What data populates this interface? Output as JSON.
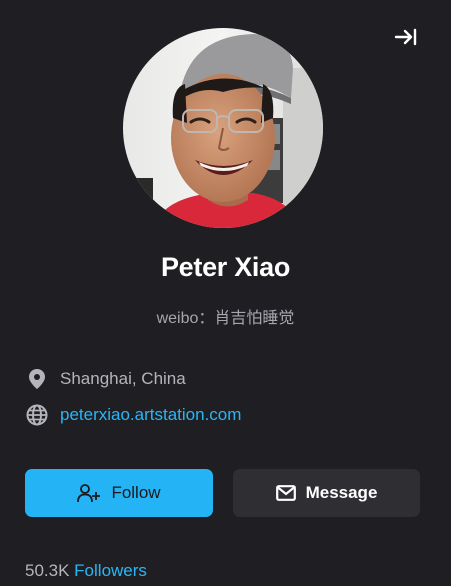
{
  "profile": {
    "name": "Peter Xiao",
    "headline": "weibo：肖吉怕睡觉",
    "location": "Shanghai, China",
    "website": "peterxiao.artstation.com"
  },
  "actions": {
    "follow_label": "Follow",
    "message_label": "Message"
  },
  "stats": {
    "followers_count": "50.3K",
    "followers_label": "Followers"
  },
  "icons": {
    "collapse": "collapse-right-icon",
    "location": "location-pin-icon",
    "website": "globe-icon",
    "follow": "add-user-icon",
    "message": "envelope-icon"
  },
  "colors": {
    "background": "#1f1f23",
    "accent": "#24b4f5",
    "link": "#29b6f6",
    "secondary_button": "#2e2e33",
    "muted_text": "#b4b4ba"
  }
}
